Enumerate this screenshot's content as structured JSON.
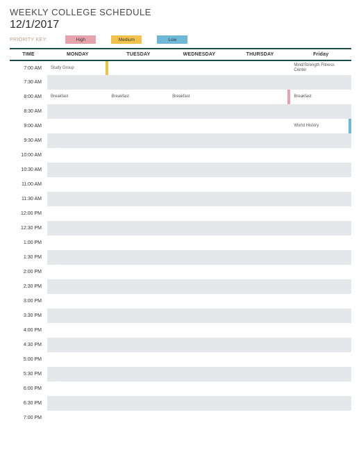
{
  "header": {
    "title": "WEEKLY COLLEGE SCHEDULE",
    "date": "12/1/2017",
    "legend_label": "PRIORITY KEY:",
    "high": "High",
    "medium": "Medium",
    "low": "Low"
  },
  "columns": [
    "TIME",
    "MONDAY",
    "TUESDAY",
    "WEDNESDAY",
    "THURSDAY",
    "Friday"
  ],
  "times": [
    "7:00 AM",
    "7:30 AM",
    "8:00 AM",
    "8:30 AM",
    "9:00 AM",
    "9:30 AM",
    "10:00 AM",
    "10:30 AM",
    "11:00 AM",
    "11:30 AM",
    "12:00 PM",
    "12:30 PM",
    "1:00 PM",
    "1:30 PM",
    "2:00 PM",
    "2:30 PM",
    "3:00 PM",
    "3:30 PM",
    "4:00 PM",
    "4:30 PM",
    "5:00 PM",
    "5:30 PM",
    "6:00 PM",
    "6:30 PM",
    "7:00 PM"
  ],
  "events": [
    {
      "row": 0,
      "col": 1,
      "text": "Study Group",
      "priority": "med"
    },
    {
      "row": 0,
      "col": 5,
      "text": "Mind/Strength Fitness Center",
      "priority": ""
    },
    {
      "row": 2,
      "col": 1,
      "text": "Breakfast",
      "priority": ""
    },
    {
      "row": 2,
      "col": 2,
      "text": "Breakfast",
      "priority": ""
    },
    {
      "row": 2,
      "col": 3,
      "text": "Breakfast",
      "priority": ""
    },
    {
      "row": 2,
      "col": 4,
      "text": "",
      "priority": "high"
    },
    {
      "row": 2,
      "col": 5,
      "text": "Breakfast",
      "priority": ""
    },
    {
      "row": 4,
      "col": 5,
      "text": "World History",
      "priority": "low"
    }
  ]
}
